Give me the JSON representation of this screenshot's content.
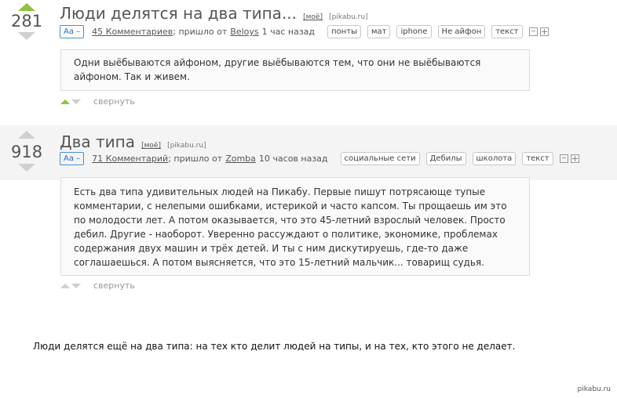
{
  "posts": [
    {
      "score": "281",
      "title": "Люди делятся на два типа...",
      "my_link": "[моё]",
      "domain": "[pikabu.ru]",
      "aa": "Aa –",
      "comments": "45 Комментариев",
      "from_prefix": "; пришло от",
      "author": "Beloys",
      "time": "1 час назад",
      "tags": [
        "понты",
        "мат",
        "iphone",
        "Не айфон",
        "текст"
      ],
      "text": "Одни выёбываются айфоном, другие выёбываются тем, что они не выёбываются айфоном. Так и живем.",
      "collapse": "свернуть"
    },
    {
      "score": "918",
      "title": "Два типа",
      "my_link": "[моё]",
      "domain": "[pikabu.ru]",
      "aa": "Aa –",
      "comments": "71 Комментарий",
      "from_prefix": "; пришло от",
      "author": "Zomba",
      "time": "10 часов назад",
      "tags": [
        "социальные сети",
        "Дебилы",
        "школота",
        "текст"
      ],
      "text": "Есть два типа удивительных людей на Пикабу. Первые пишут потрясающе тупые комментарии, с нелепыми ошибками, истерикой и часто капсом. Ты прощаешь им это по молодости лет. А потом оказывается, что это 45-летний взрослый человек. Просто дебил. Другие - наоборот. Уверенно рассуждают о политике, экономике, проблемах содержания двух машин и трёх детей. И ты с ним дискутируешь, где-то даже соглашаешься. А потом выясняется, что это 15-летний мальчик... товарищ судья.",
      "collapse": "свернуть"
    }
  ],
  "caption": "Люди делятся ещё на два типа: на тех кто делит людей на типы, и на тех, кто этого не делает.",
  "watermark": "pikabu.ru"
}
